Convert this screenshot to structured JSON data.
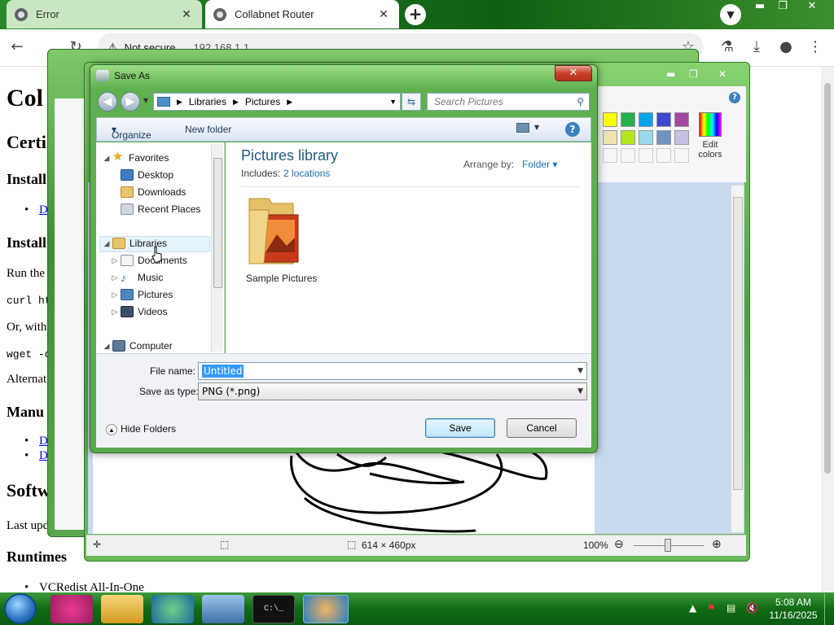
{
  "browser": {
    "tabs": [
      {
        "label": "Error"
      },
      {
        "label": "Collabnet Router"
      }
    ],
    "new_tab": "+",
    "address": {
      "security": "Not secure",
      "url": "192.168.1.1"
    }
  },
  "webpage": {
    "h1": "Col",
    "h2a": "Certi",
    "h3a": "Install",
    "link1": "D",
    "h3b": "Install",
    "p_run": "Run the",
    "code1": "curl ht",
    "p_or": "Or, with",
    "code2": "wget -q",
    "p_alt": "Alternat",
    "h3c": "Manu",
    "link2": "D",
    "link3": "D",
    "h2b": "Softw",
    "p_last": "Last upd",
    "h3d": "Runtimes",
    "li_vc": "VCRedist All-In-One"
  },
  "paint": {
    "edit_colors_label": "Edit colors",
    "status_size": "614 × 460px",
    "zoom": "100%",
    "palette": [
      "#ffff00",
      "#22b14c",
      "#00a2e8",
      "#3f48cc",
      "#a349a4",
      "#efe4b0",
      "#b5e61d",
      "#99d9ea",
      "#7092be",
      "#c8bfe7"
    ]
  },
  "dialog": {
    "title": "Save As",
    "close": "✕",
    "breadcrumb": [
      "Libraries",
      "Pictures"
    ],
    "search_placeholder": "Search Pictures",
    "organize": "Organize",
    "new_folder": "New folder",
    "nav": {
      "favorites": "Favorites",
      "desktop": "Desktop",
      "downloads": "Downloads",
      "recent": "Recent Places",
      "libraries": "Libraries",
      "documents": "Documents",
      "music": "Music",
      "pictures": "Pictures",
      "videos": "Videos",
      "computer": "Computer"
    },
    "library_title": "Pictures library",
    "includes_label": "Includes:",
    "includes_link": "2 locations",
    "arrange_label": "Arrange by:",
    "arrange_value": "Folder",
    "folder_item": "Sample Pictures",
    "file_name_label": "File name:",
    "file_name_value": "Untitled",
    "save_type_label": "Save as type:",
    "save_type_value": "PNG (*.png)",
    "hide_folders": "Hide Folders",
    "save": "Save",
    "cancel": "Cancel"
  },
  "taskbar": {
    "time": "5:08 AM",
    "date": "11/16/2025"
  }
}
